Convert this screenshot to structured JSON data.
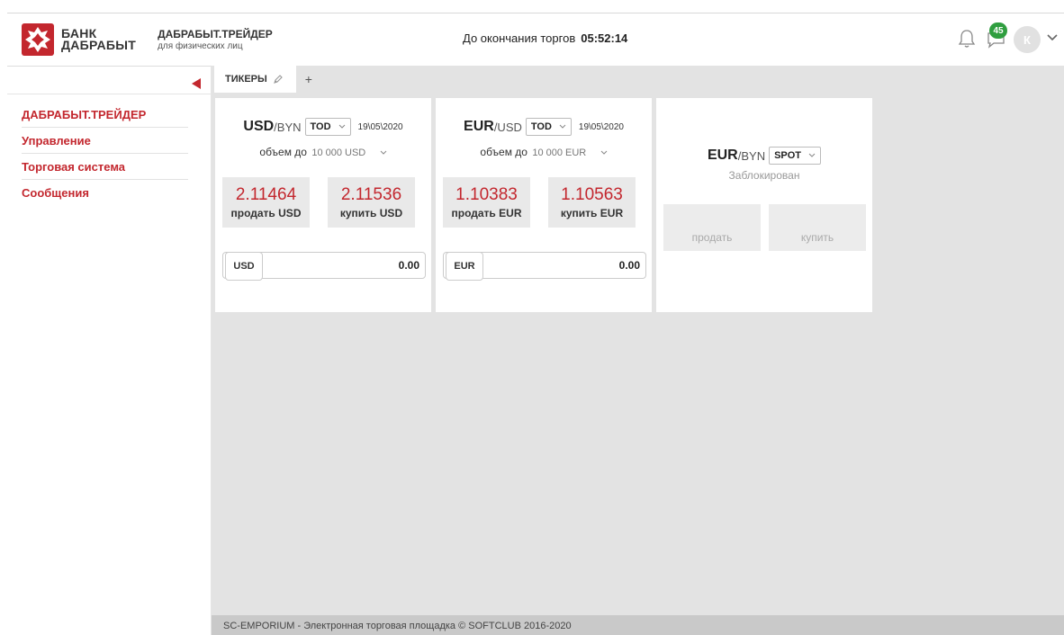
{
  "header": {
    "logo_line1": "БАНК",
    "logo_line2": "ДАБРАБЫТ",
    "brand_title": "ДАБРАБЫТ.ТРЕЙДЕР",
    "brand_subtitle": "для физических лиц",
    "countdown_label": "До окончания торгов",
    "countdown_time": "05:52:14",
    "notifications_count": "45",
    "avatar_initial": "К"
  },
  "sidebar": {
    "items": [
      {
        "label": "ДАБРАБЫТ.ТРЕЙДЕР"
      },
      {
        "label": "Управление"
      },
      {
        "label": "Торговая система"
      },
      {
        "label": "Сообщения"
      }
    ]
  },
  "tabs": [
    {
      "label": "ТИКЕРЫ"
    }
  ],
  "tab_add_label": "+",
  "tickers": [
    {
      "base": "USD",
      "quote": "/BYN",
      "term": "TOD",
      "date": "19\\05\\2020",
      "volume_label": "объем до",
      "volume_value": "10 000 USD",
      "sell_rate": "2.11464",
      "sell_label": "продать USD",
      "buy_rate": "2.11536",
      "buy_label": "купить USD",
      "amount_currency": "USD",
      "amount_value": "0.00"
    },
    {
      "base": "EUR",
      "quote": "/USD",
      "term": "TOD",
      "date": "19\\05\\2020",
      "volume_label": "объем до",
      "volume_value": "10 000 EUR",
      "sell_rate": "1.10383",
      "sell_label": "продать EUR",
      "buy_rate": "1.10563",
      "buy_label": "купить EUR",
      "amount_currency": "EUR",
      "amount_value": "0.00"
    },
    {
      "base": "EUR",
      "quote": "/BYN",
      "term": "SPOT",
      "status": "Заблокирован",
      "sell_label": "продать",
      "buy_label": "купить"
    }
  ],
  "footer": {
    "text": "SC-EMPORIUM - Электронная торговая площадка © SOFTCLUB 2016-2020"
  },
  "colors": {
    "accent": "#c3272e",
    "badge": "#2f9e3f",
    "content_bg": "#e3e3e3"
  }
}
